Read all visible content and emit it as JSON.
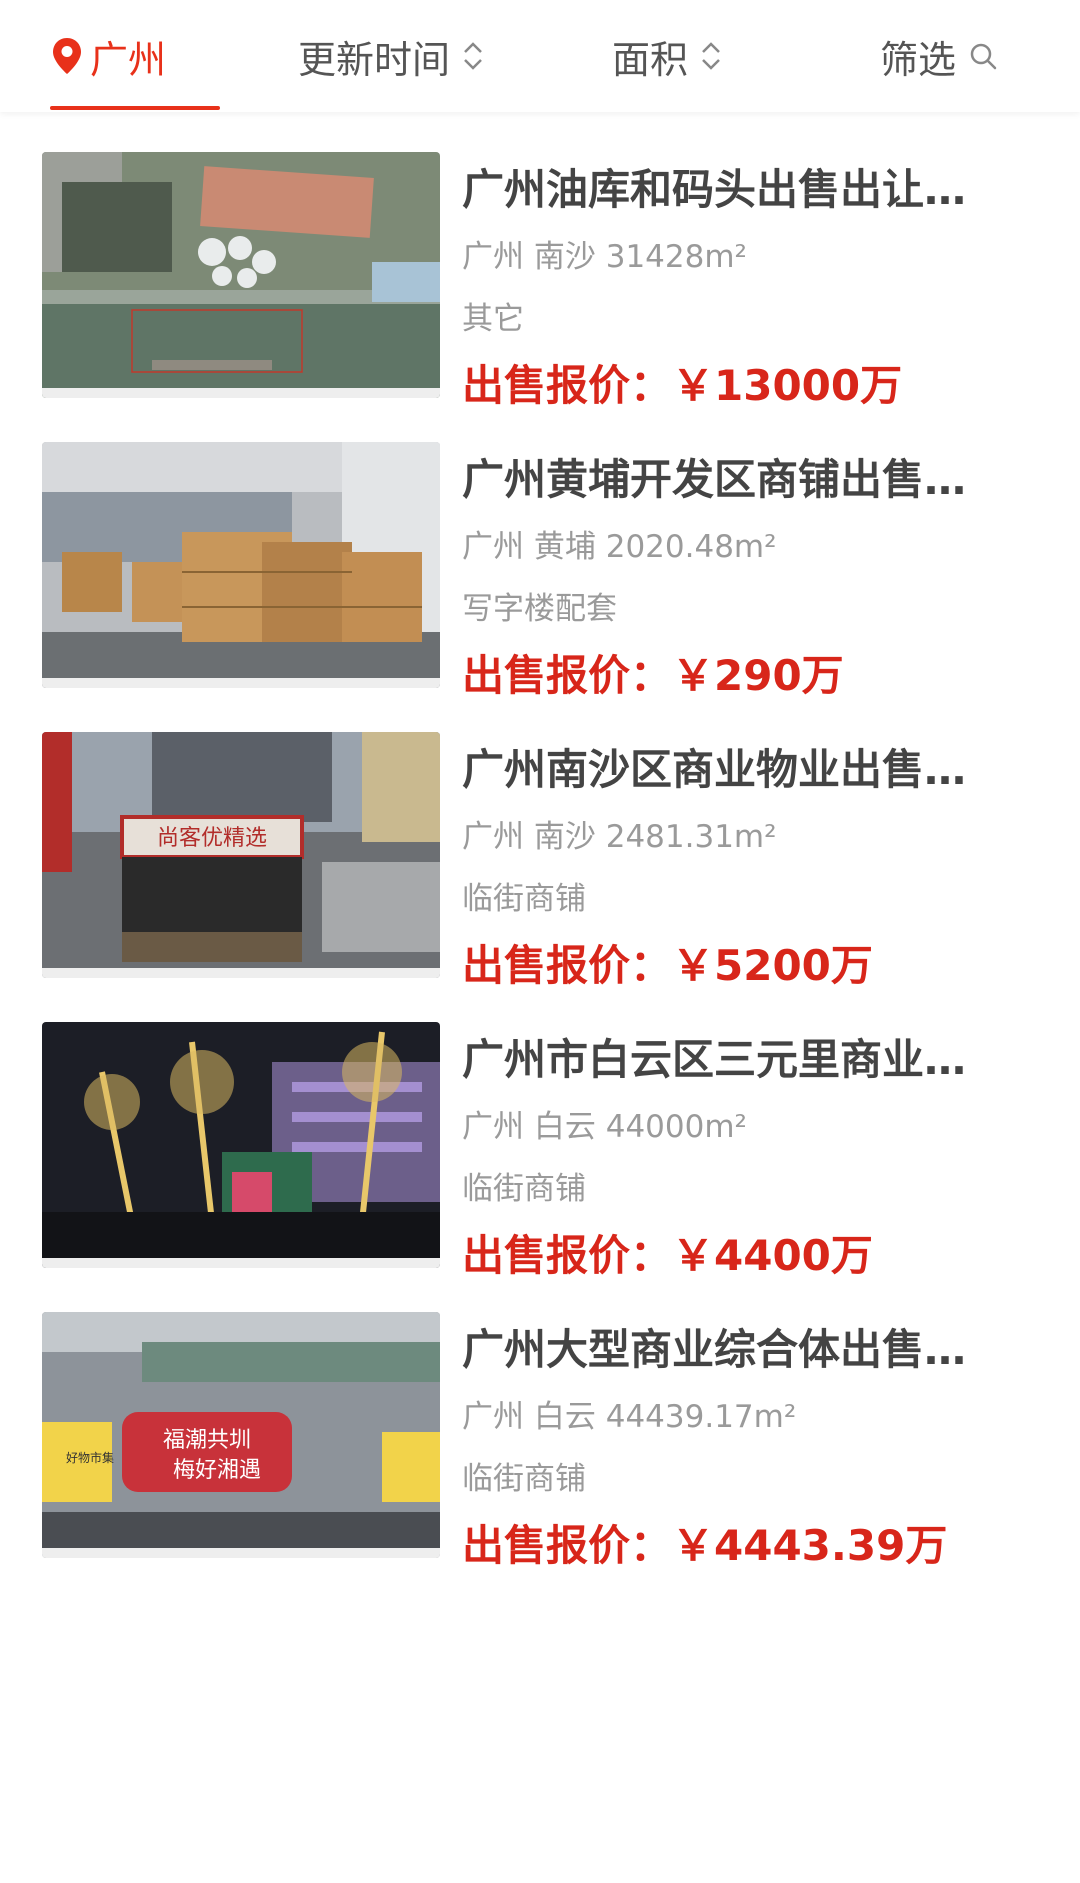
{
  "filter_bar": {
    "city": "广州",
    "update_time": "更新时间",
    "area": "面积",
    "filter": "筛选"
  },
  "accent_color": "#e8311a",
  "price_color": "#d8261a",
  "listings": [
    {
      "title": "广州油库和码头出售出让…",
      "city": "广州",
      "district": "南沙",
      "area": "31428",
      "unit": "m²",
      "type": "其它",
      "price_label": "出售报价：",
      "price": "￥13000万",
      "image": "aerial-view-oil-depot-dock"
    },
    {
      "title": "广州黄埔开发区商铺出售…",
      "city": "广州",
      "district": "黄埔",
      "area": "2020.48",
      "unit": "m²",
      "type": "写字楼配套",
      "price_label": "出售报价：",
      "price": "￥290万",
      "image": "warehouse-with-boxes"
    },
    {
      "title": "广州南沙区商业物业出售…",
      "city": "广州",
      "district": "南沙",
      "area": "2481.31",
      "unit": "m²",
      "type": "临街商铺",
      "price_label": "出售报价：",
      "price": "￥5200万",
      "image": "storefront-building",
      "sign_text": "尚客优精选"
    },
    {
      "title": "广州市白云区三元里商业…",
      "city": "广州",
      "district": "白云",
      "area": "44000",
      "unit": "m²",
      "type": "临街商铺",
      "price_label": "出售报价：",
      "price": "￥4400万",
      "image": "night-street-lit-trees"
    },
    {
      "title": "广州大型商业综合体出售…",
      "city": "广州",
      "district": "白云",
      "area": "44439.17",
      "unit": "m²",
      "type": "临街商铺",
      "price_label": "出售报价：",
      "price": "￥4443.39万",
      "image": "commercial-complex-banner",
      "banner_text_1": "福潮共圳",
      "banner_text_2": "梅好湘遇",
      "side_sign_text": "好物市集"
    }
  ]
}
